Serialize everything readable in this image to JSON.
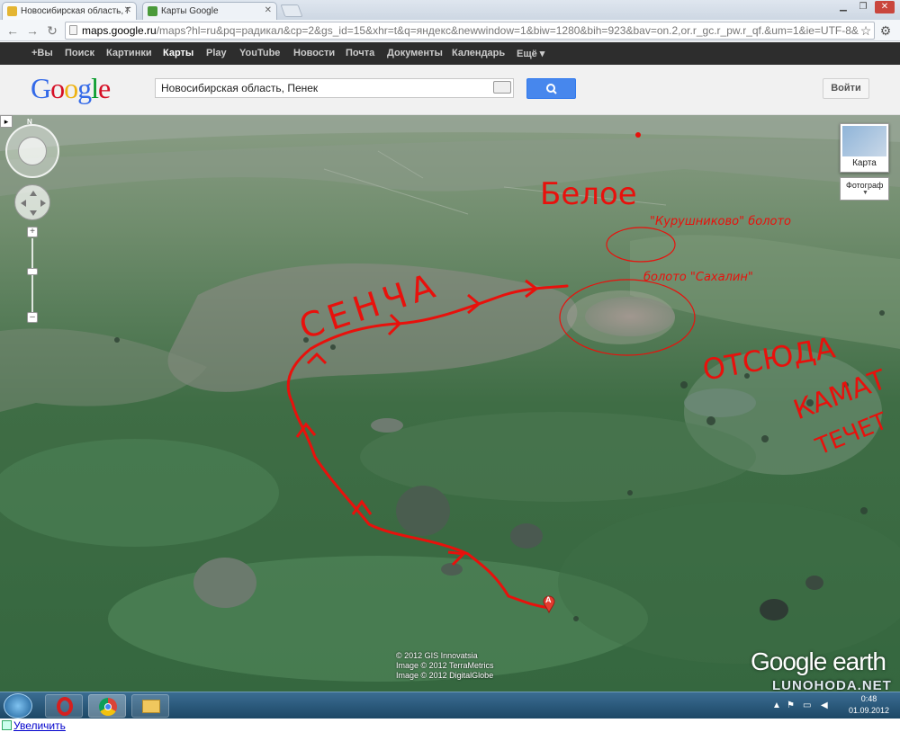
{
  "browser": {
    "tabs": [
      {
        "title": "Новосибирская область, Г",
        "active": true
      },
      {
        "title": "Карты Google",
        "active": false
      }
    ],
    "url_host": "maps.google.ru",
    "url_rest": "/maps?hl=ru&pq=радикал&cp=2&gs_id=15&xhr=t&q=яндекс&newwindow=1&biw=1280&bih=923&bav=on.2,or.r_gc.r_pw.r_qf.&um=1&ie=UTF-8&"
  },
  "google_bar": {
    "items": [
      {
        "label": "+Вы",
        "active": false
      },
      {
        "label": "Поиск",
        "active": false
      },
      {
        "label": "Картинки",
        "active": false
      },
      {
        "label": "Карты",
        "active": true
      },
      {
        "label": "Play",
        "active": false
      },
      {
        "label": "YouTube",
        "active": false
      },
      {
        "label": "Новости",
        "active": false
      },
      {
        "label": "Почта",
        "active": false
      },
      {
        "label": "Документы",
        "active": false
      },
      {
        "label": "Календарь",
        "active": false
      },
      {
        "label": "Ещё ▾",
        "active": false
      }
    ]
  },
  "header": {
    "logo_letters": [
      "G",
      "o",
      "o",
      "g",
      "l",
      "e"
    ],
    "logo_colors": [
      "#3369e8",
      "#d50f25",
      "#eeb211",
      "#3369e8",
      "#009925",
      "#d50f25"
    ],
    "search_value": "Новосибирская область, Пенек",
    "login_label": "Войти"
  },
  "map": {
    "layer_map_label": "Карта",
    "layer_photo_label": "Фотограф",
    "north_label": "N",
    "marker_label": "A",
    "copyright": [
      "© 2012 GIS Innovatsia",
      "Image © 2012 TerraMetrics",
      "Image © 2012 DigitalGlobe"
    ],
    "brand": "Google earth",
    "watermark": "LUNOHODA.NET",
    "annotations": {
      "sencha": "СЕНЧА",
      "beloe": "Белое",
      "kurushnikovo": "\"Курушниково\" болото",
      "sakhalin": "болото \"Сахалин\"",
      "otsyuda_1": "ОТСЮДА",
      "otsyuda_2": "КАМАТ",
      "otsyuda_3": "ТЕЧЕТ"
    }
  },
  "taskbar": {
    "time": "0:48",
    "date": "01.09.2012"
  },
  "footer": {
    "zoom_link": "Увеличить"
  },
  "colors": {
    "annotation_red": "#e8110c",
    "google_bar_bg": "#2d2d2d",
    "search_button": "#4787ed"
  }
}
